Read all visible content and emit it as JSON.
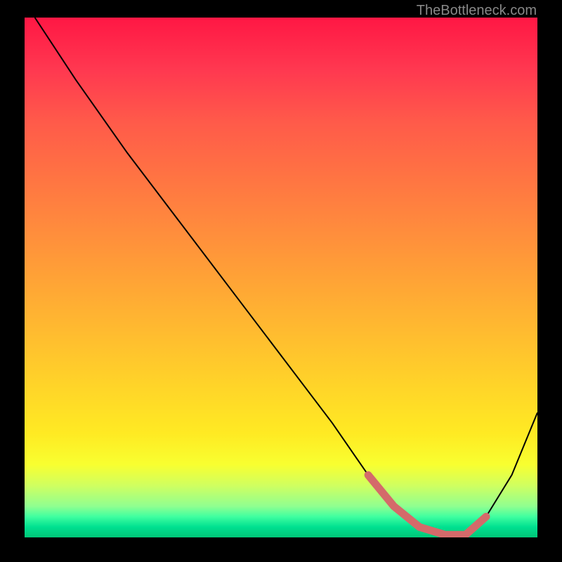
{
  "watermark": "TheBottleneck.com",
  "chart_data": {
    "type": "line",
    "title": "",
    "xlabel": "",
    "ylabel": "",
    "xlim": [
      0,
      100
    ],
    "ylim": [
      0,
      100
    ],
    "series": [
      {
        "name": "main-curve",
        "color": "#000000",
        "x": [
          2,
          10,
          20,
          30,
          40,
          50,
          60,
          67,
          72,
          77,
          82,
          86,
          90,
          95,
          100
        ],
        "y": [
          100,
          88,
          74,
          61,
          48,
          35,
          22,
          12,
          6,
          2,
          0.5,
          0.5,
          4,
          12,
          24
        ]
      },
      {
        "name": "highlight-segment",
        "color": "#d46a6a",
        "x": [
          67,
          72,
          77,
          82,
          86,
          90
        ],
        "y": [
          12,
          6,
          2,
          0.5,
          0.5,
          4
        ]
      }
    ],
    "gradient_stops": [
      {
        "pos": 0,
        "color": "#ff1744"
      },
      {
        "pos": 50,
        "color": "#ffa236"
      },
      {
        "pos": 85,
        "color": "#ffff23"
      },
      {
        "pos": 100,
        "color": "#00c878"
      }
    ]
  }
}
